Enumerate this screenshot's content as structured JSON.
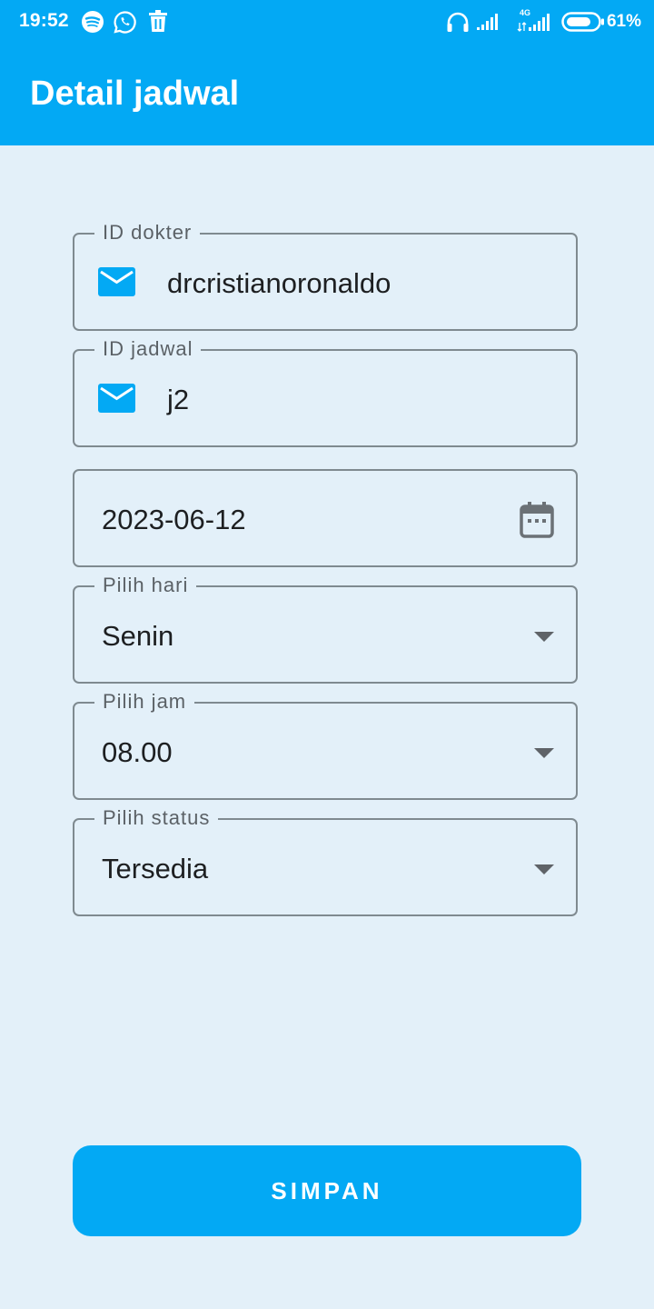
{
  "status_bar": {
    "time": "19:52",
    "left_icons": [
      "spotify-icon",
      "whatsapp-icon",
      "trash-icon"
    ],
    "right_icons": [
      "headphones-icon",
      "signal-icon",
      "signal-4g-icon",
      "battery-icon"
    ],
    "network_label": "4G",
    "battery_percent": "61%"
  },
  "app_bar": {
    "title": "Detail jadwal",
    "color": "#03a9f4"
  },
  "form": {
    "doctor_id": {
      "label": "ID dokter",
      "value": "drcristianoronaldo",
      "icon": "email-icon"
    },
    "schedule_id": {
      "label": "ID jadwal",
      "value": "j2",
      "icon": "email-icon"
    },
    "date": {
      "value": "2023-06-12",
      "icon": "calendar-icon"
    },
    "day": {
      "label": "Pilih hari",
      "value": "Senin"
    },
    "hour": {
      "label": "Pilih jam",
      "value": "08.00"
    },
    "status": {
      "label": "Pilih status",
      "value": "Tersedia"
    }
  },
  "save_button": {
    "label": "SIMPAN"
  }
}
